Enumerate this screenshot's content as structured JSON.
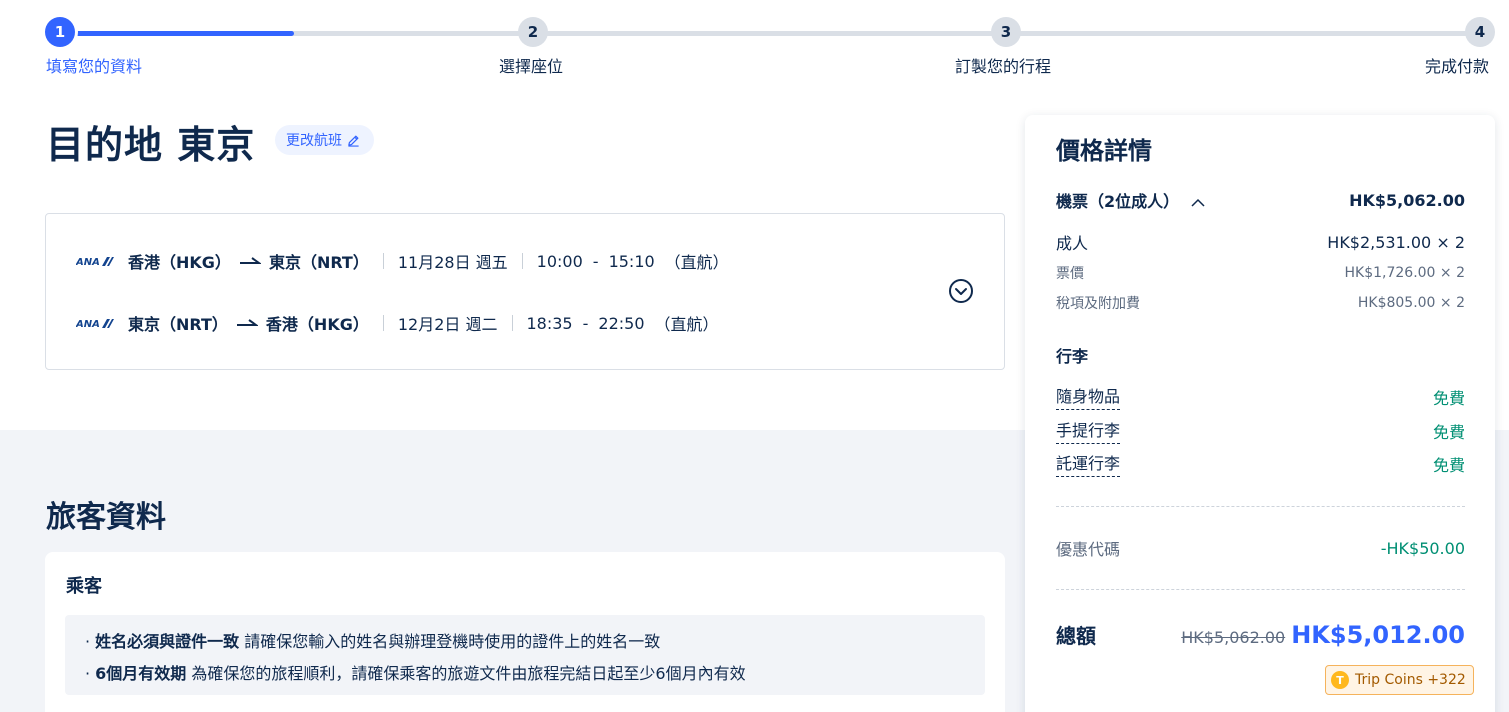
{
  "stepper": {
    "current_step": 1,
    "steps": [
      {
        "num": "1",
        "label": "填寫您的資料"
      },
      {
        "num": "2",
        "label": "選擇座位"
      },
      {
        "num": "3",
        "label": "訂製您的行程"
      },
      {
        "num": "4",
        "label": "完成付款"
      }
    ]
  },
  "destination": {
    "title": "目的地 東京",
    "change_label": "更改航班"
  },
  "flights": [
    {
      "airline": "ANA",
      "from": "香港（HKG）",
      "to": "東京（NRT）",
      "date": "11月28日 週五",
      "depart": "10:00",
      "dash": "-",
      "arrive": "15:10",
      "type": "（直航）"
    },
    {
      "airline": "ANA",
      "from": "東京（NRT）",
      "to": "香港（HKG）",
      "date": "12月2日 週二",
      "depart": "18:35",
      "dash": "-",
      "arrive": "22:50",
      "type": "（直航）"
    }
  ],
  "travelers": {
    "section_title": "旅客資料",
    "passenger_title": "乘客",
    "notices": [
      {
        "bold": "姓名必須與證件一致",
        "text": " 請確保您輸入的姓名與辦理登機時使用的證件上的姓名一致"
      },
      {
        "bold": "6個月有效期",
        "text": " 為確保您的旅程順利，請確保乘客的旅遊文件由旅程完結日起至少6個月內有效"
      }
    ]
  },
  "price": {
    "title": "價格詳情",
    "ticket_label": "機票（2位成人）",
    "ticket_total": "HK$5,062.00",
    "adult_label": "成人",
    "adult_value": "HK$2,531.00 × 2",
    "fare_label": "票價",
    "fare_value": "HK$1,726.00 × 2",
    "tax_label": "稅項及附加費",
    "tax_value": "HK$805.00 × 2",
    "baggage_title": "行李",
    "baggage": [
      {
        "label": "隨身物品",
        "value": "免費"
      },
      {
        "label": "手提行李",
        "value": "免費"
      },
      {
        "label": "託運行李",
        "value": "免費"
      }
    ],
    "promo_label": "優惠代碼",
    "promo_value": "-HK$50.00",
    "total_label": "總額",
    "total_old": "HK$5,062.00",
    "total_new": "HK$5,012.00",
    "coins_label": "Trip Coins +322",
    "coin_symbol": "T"
  },
  "colors": {
    "accent": "#3264ff",
    "free": "#008f73",
    "text": "#0f294d"
  }
}
